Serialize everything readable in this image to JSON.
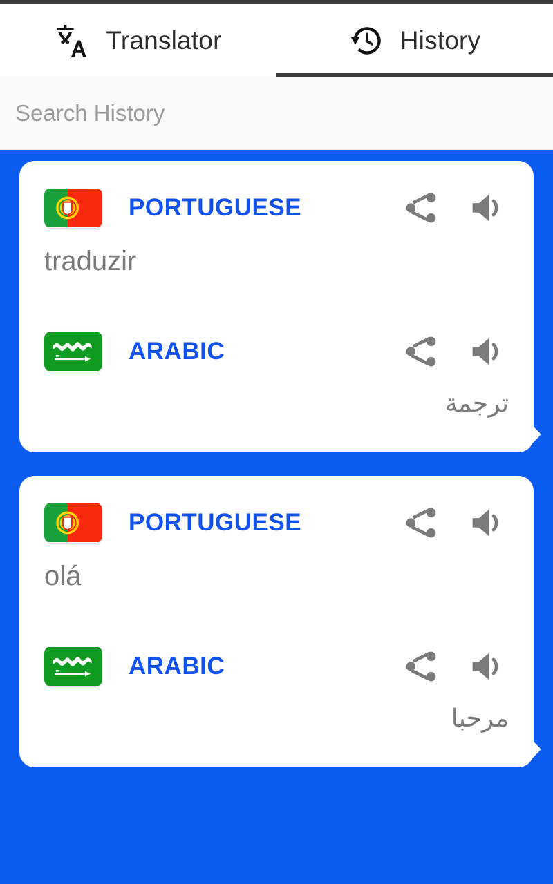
{
  "app": {
    "background_color": "#0b5cf0",
    "accent_color": "#1152ee",
    "text_muted_color": "#7a7a7a"
  },
  "tabs": [
    {
      "id": "translator",
      "label": "Translator",
      "icon": "translate-icon",
      "active": false
    },
    {
      "id": "history",
      "label": "History",
      "icon": "history-clock-icon",
      "active": true
    }
  ],
  "search": {
    "value": "",
    "placeholder": "Search History"
  },
  "history_cards": [
    {
      "source": {
        "language": "PORTUGUESE",
        "flag": "portugal-flag",
        "text": "traduzir",
        "rtl": false,
        "share_label": "share-icon",
        "speak_label": "speaker-icon"
      },
      "target": {
        "language": "ARABIC",
        "flag": "saudi-arabia-flag",
        "text": "ترجمة",
        "rtl": true,
        "share_label": "share-icon",
        "speak_label": "speaker-icon"
      }
    },
    {
      "source": {
        "language": "PORTUGUESE",
        "flag": "portugal-flag",
        "text": "olá",
        "rtl": false,
        "share_label": "share-icon",
        "speak_label": "speaker-icon"
      },
      "target": {
        "language": "ARABIC",
        "flag": "saudi-arabia-flag",
        "text": "مرحبا",
        "rtl": true,
        "share_label": "share-icon",
        "speak_label": "speaker-icon"
      }
    }
  ]
}
